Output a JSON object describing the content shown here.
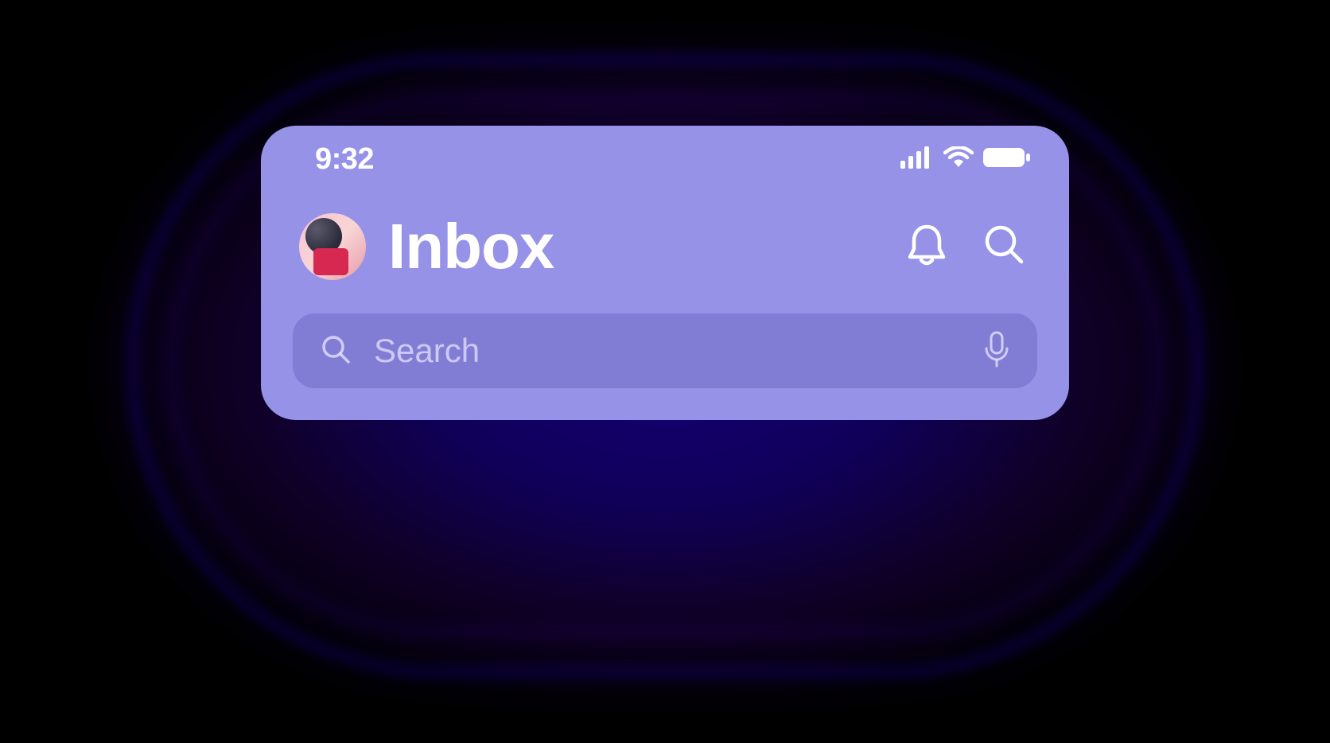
{
  "status_bar": {
    "time": "9:32"
  },
  "header": {
    "title": "Inbox"
  },
  "search": {
    "placeholder": "Search",
    "value": ""
  }
}
